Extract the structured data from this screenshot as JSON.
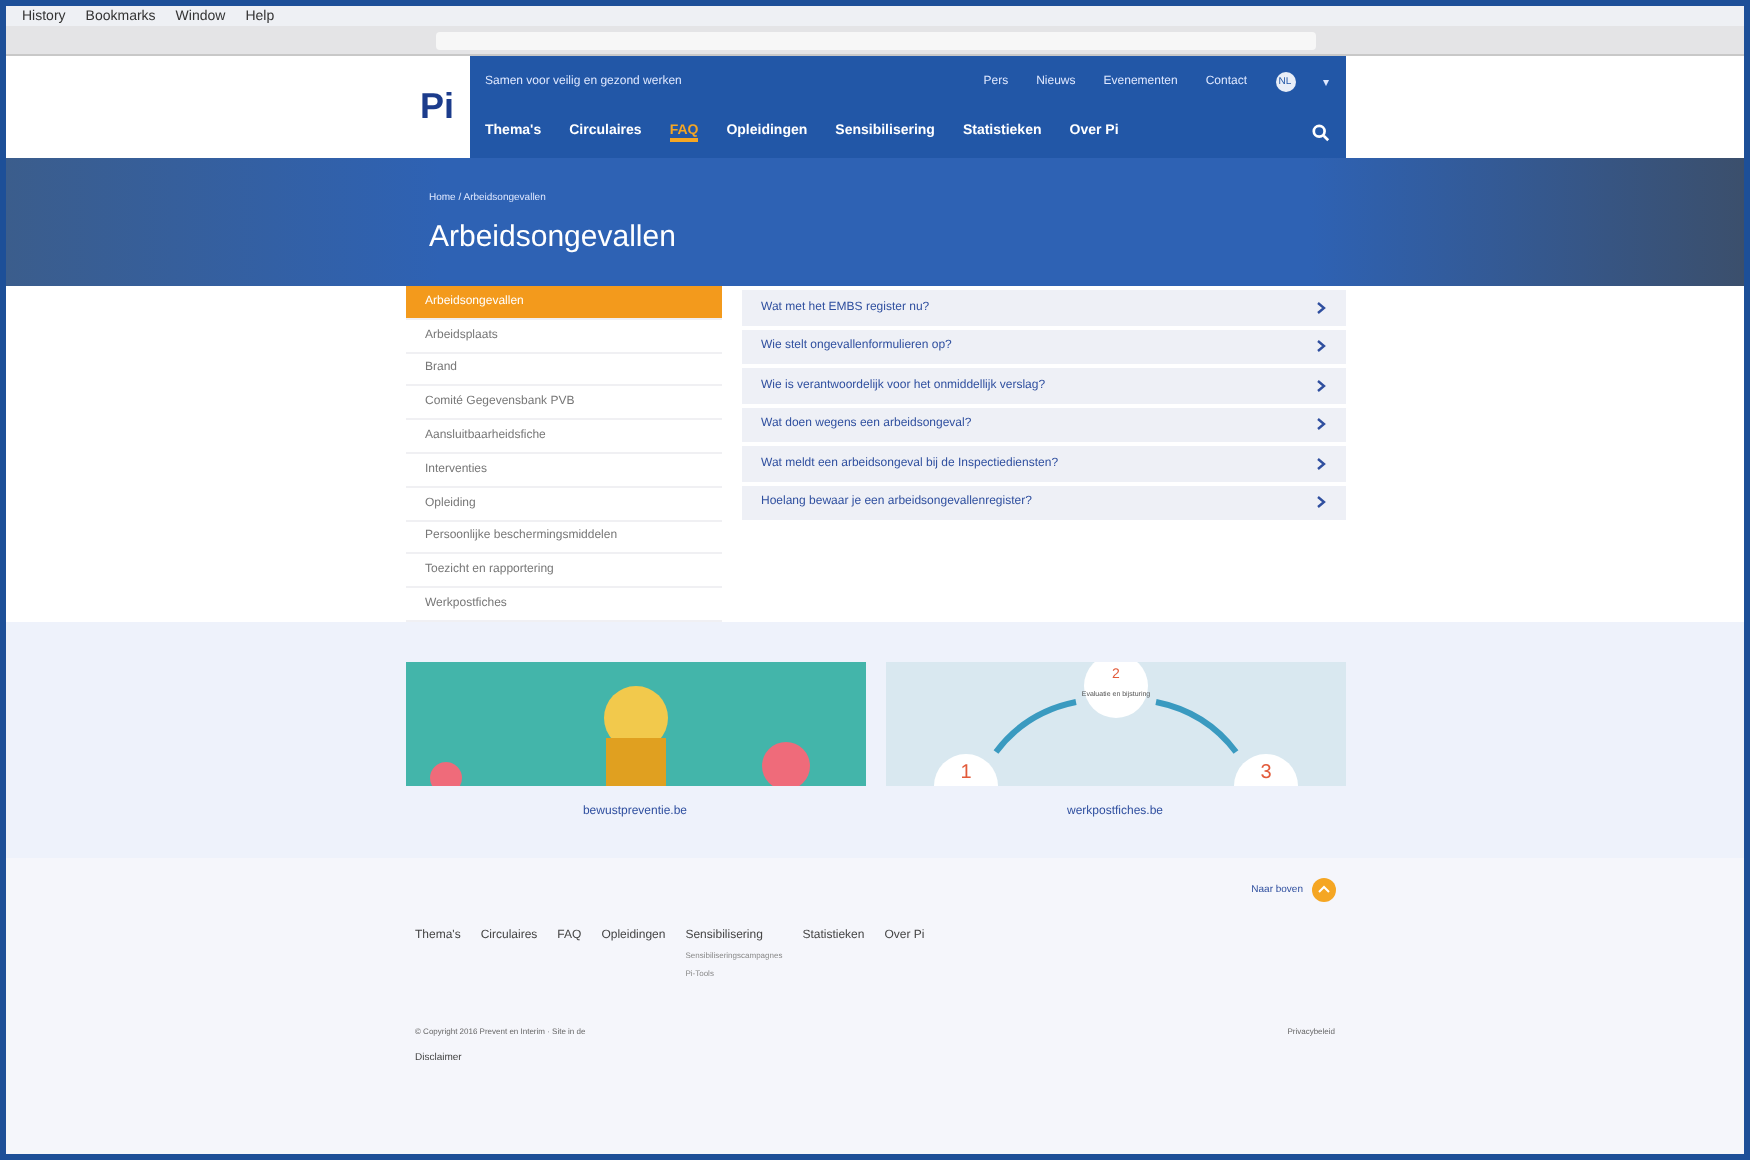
{
  "browser": {
    "menu": [
      "History",
      "Bookmarks",
      "Window",
      "Help"
    ]
  },
  "header": {
    "logo": "Pi",
    "tagline": "Samen voor veilig en gezond werken",
    "top_links": [
      "Pers",
      "Nieuws",
      "Evenementen",
      "Contact"
    ],
    "language": "NL",
    "caret": "▾",
    "nav": [
      {
        "label": "Thema's",
        "selected": false
      },
      {
        "label": "Circulaires",
        "selected": false
      },
      {
        "label": "FAQ",
        "selected": true
      },
      {
        "label": "Opleidingen",
        "selected": false
      },
      {
        "label": "Sensibilisering",
        "selected": false
      },
      {
        "label": "Statistieken",
        "selected": false
      },
      {
        "label": "Over Pi",
        "selected": false
      }
    ]
  },
  "hero": {
    "breadcrumb": "Home / Arbeidsongevallen",
    "title": "Arbeidsongevallen"
  },
  "sidebar": {
    "items": [
      {
        "label": "Arbeidsongevallen",
        "selected": true
      },
      {
        "label": "Arbeidsplaats",
        "selected": false
      },
      {
        "label": "Brand",
        "selected": false
      },
      {
        "label": "Comité Gegevensbank PVB",
        "selected": false
      },
      {
        "label": "Aansluitbaarheidsfiche",
        "selected": false
      },
      {
        "label": "Interventies",
        "selected": false
      },
      {
        "label": "Opleiding",
        "selected": false
      },
      {
        "label": "Persoonlijke beschermingsmiddelen",
        "selected": false
      },
      {
        "label": "Toezicht en rapportering",
        "selected": false
      },
      {
        "label": "Werkpostfiches",
        "selected": false
      }
    ]
  },
  "questions": [
    "Wat met het EMBS register nu?",
    "Wie stelt ongevallenformulieren op?",
    "Wie is verantwoordelijk voor het onmiddellijk verslag?",
    "Wat doen wegens een arbeidsongeval?",
    "Wat meldt een arbeidsongeval bij de Inspectiediensten?",
    "Hoelang bewaar je een arbeidsongevallenregister?"
  ],
  "promos": [
    {
      "kind": "illustration",
      "caption": "bewustpreventie.be"
    },
    {
      "kind": "cycle",
      "caption": "werkpostfiches.be",
      "steps": [
        "1",
        "2",
        "3"
      ],
      "center": "Evaluatie en bijsturing"
    }
  ],
  "footer": {
    "back_to_top": "Naar boven",
    "nav": [
      "Thema's",
      "Circulaires",
      "FAQ",
      "Opleidingen",
      "Sensibilisering",
      "Statistieken",
      "Over Pi"
    ],
    "sub_links": [
      "Sensibiliseringscampagnes",
      "Pi-Tools"
    ],
    "copyright": "© Copyright 2016 Prevent en Interim · Site in de",
    "privacy": "Privacybeleid",
    "disclaimer": "Disclaimer"
  }
}
